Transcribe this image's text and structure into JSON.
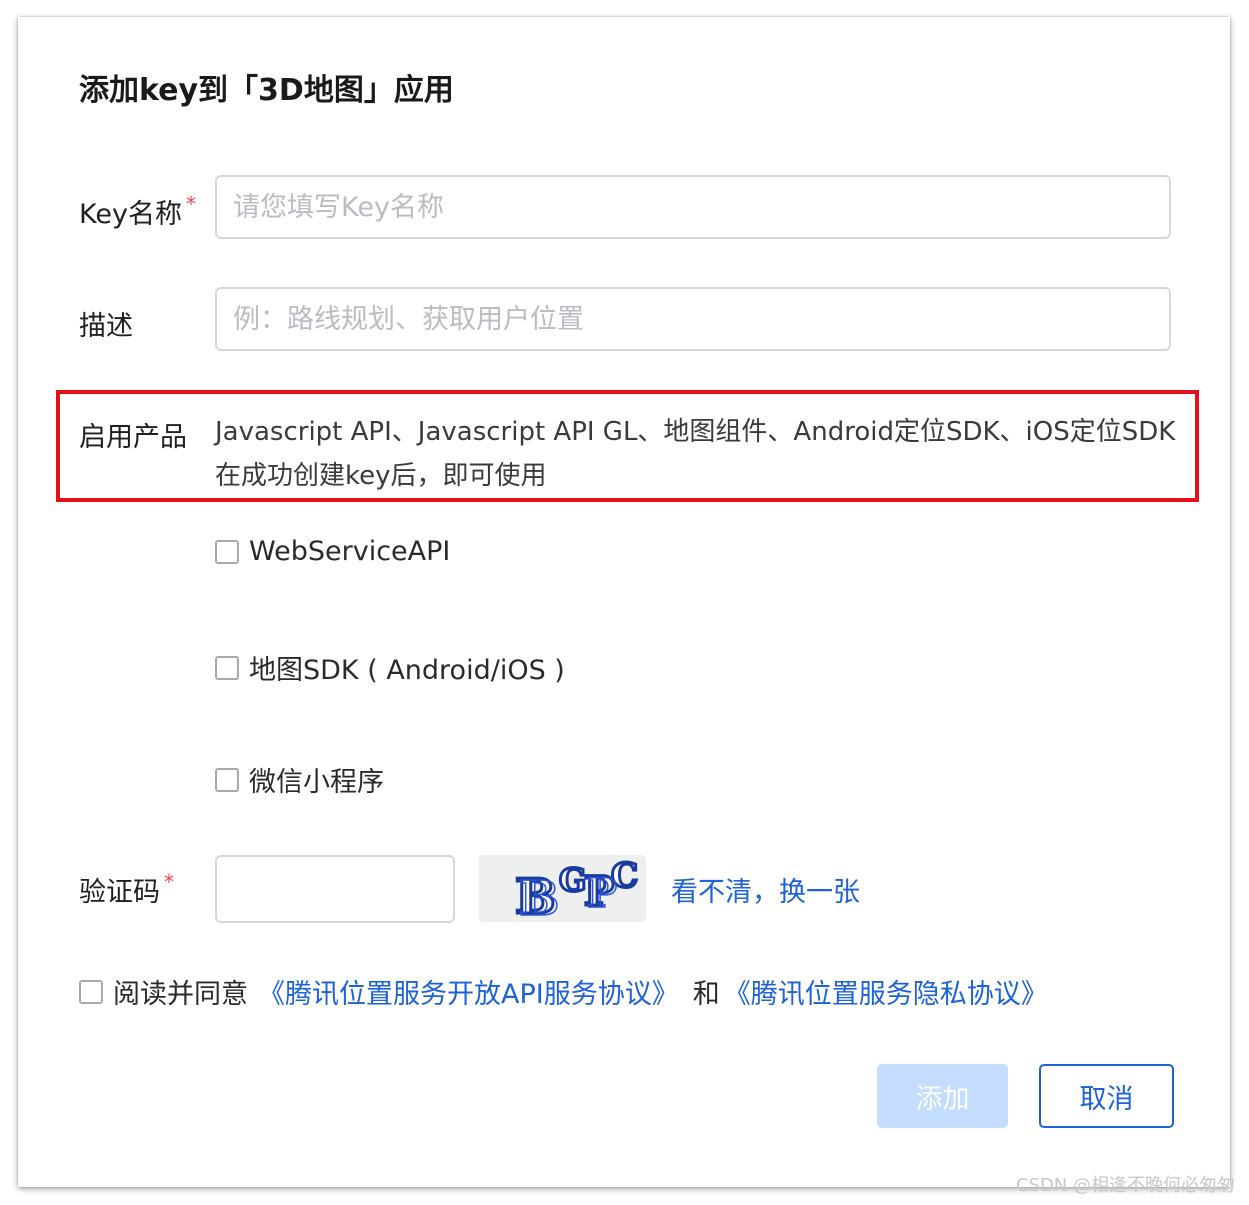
{
  "dialog": {
    "title": "添加key到「3D地图」应用"
  },
  "form": {
    "key_name": {
      "label": "Key名称",
      "required_mark": "*",
      "placeholder": "请您填写Key名称",
      "value": ""
    },
    "description": {
      "label": "描述",
      "placeholder": "例：路线规划、获取用户位置",
      "value": ""
    },
    "products": {
      "label": "启用产品",
      "text": "Javascript API、Javascript API GL、地图组件、Android定位SDK、iOS定位SDK在成功创建key后，即可使用",
      "options": [
        {
          "label": "WebServiceAPI",
          "checked": false
        },
        {
          "label": "地图SDK ( Android/iOS )",
          "checked": false
        },
        {
          "label": "微信小程序",
          "checked": false
        }
      ]
    },
    "captcha": {
      "label": "验证码",
      "required_mark": "*",
      "value": "",
      "image_text": "BGPC",
      "refresh_link": "看不清，换一张"
    },
    "agreement": {
      "checked": false,
      "prefix": "阅读并同意",
      "link1": "《腾讯位置服务开放API服务协议》",
      "and": "和",
      "link2": "《腾讯位置服务隐私协议》"
    }
  },
  "buttons": {
    "add": "添加",
    "cancel": "取消"
  },
  "watermark": "CSDN @相逢不晚何必匆匆",
  "colors": {
    "primary": "#1d62d6",
    "primary_disabled": "#c4dcfd",
    "required": "#e5484d",
    "highlight_border": "#e3121a"
  }
}
